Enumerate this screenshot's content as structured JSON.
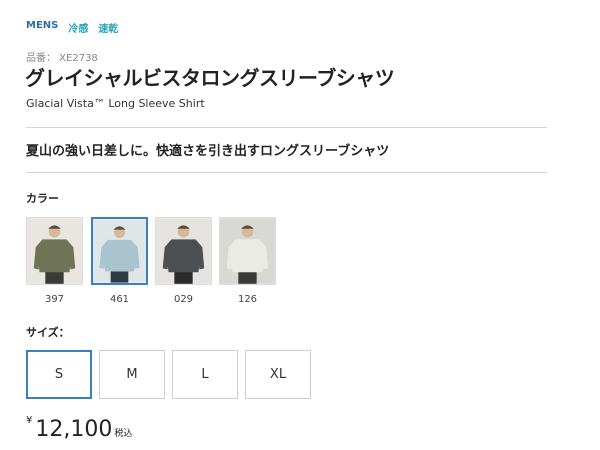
{
  "tags": {
    "mens": "MENS",
    "cool": "冷感",
    "dry": "速乾"
  },
  "product": {
    "code": "品番： XE2738",
    "title": "グレイシャルビスタロングスリーブシャツ",
    "subtitle": "Glacial Vista™ Long Sleeve Shirt",
    "tagline": "夏山の強い日差しに。快適さを引き出すロングスリーブシャツ"
  },
  "color": {
    "label": "カラー",
    "selected": "461",
    "swatches": [
      {
        "code": "397",
        "shirt": "#6f7456",
        "bg": "#e9e6df",
        "pants": "#3d3a35"
      },
      {
        "code": "461",
        "shirt": "#a9c3cf",
        "bg": "#dfe6e8",
        "pants": "#2f3a45"
      },
      {
        "code": "029",
        "shirt": "#4d5052",
        "bg": "#e4e3e0",
        "pants": "#2b2b2b"
      },
      {
        "code": "126",
        "shirt": "#e9ebe4",
        "bg": "#d8d8d4",
        "pants": "#3a3a38"
      }
    ]
  },
  "size": {
    "label": "サイズ：",
    "selected": "S",
    "options": [
      "S",
      "M",
      "L",
      "XL"
    ]
  },
  "price": {
    "currency": "¥",
    "amount": "12,100",
    "tax": "税込"
  },
  "colors": {
    "accent": "#3a7fc0",
    "mens": "#2a6fa8",
    "feature": "#2aa5b8"
  }
}
